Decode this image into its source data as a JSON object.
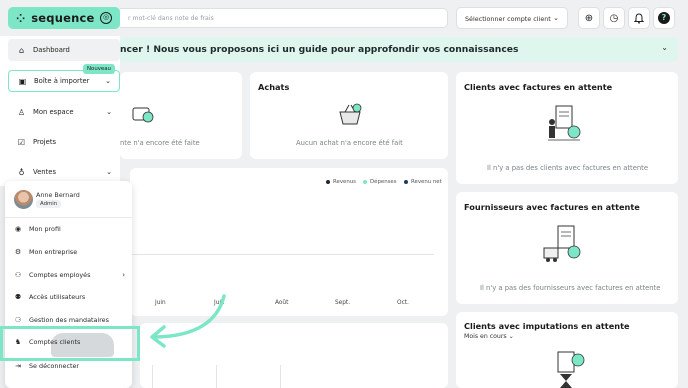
{
  "brand": {
    "name": "sequence",
    "mark": "⁘",
    "accent": "#7de6c6"
  },
  "search": {
    "placeholder": "r mot-clé dans note de frais"
  },
  "client_select": {
    "label": "Sélectionner compte client",
    "chevron": "chevron-down-icon"
  },
  "toolbar_icons": [
    "add-circle-icon",
    "clock-icon",
    "bell-icon",
    "help-icon"
  ],
  "banner": {
    "text": "ncer ! Nous vous proposons ici un guide pour approfondir vos connaissances"
  },
  "sidebar": {
    "items": [
      {
        "label": "Dashboard",
        "icon": "home-icon"
      },
      {
        "label": "Boîte à importer",
        "icon": "inbox-icon",
        "badge": "Nouveau"
      },
      {
        "label": "Mon espace",
        "icon": "user-icon"
      },
      {
        "label": "Projets",
        "icon": "check-square-icon"
      },
      {
        "label": "Ventes",
        "icon": "money-bag-icon"
      }
    ]
  },
  "cards": {
    "sales_partial": {
      "empty": "nte n'a encore été faite"
    },
    "purchases": {
      "title": "Achats",
      "empty": "Aucun achat n'a encore été fait"
    },
    "clients_pending": {
      "title": "Clients avec factures en attente",
      "empty": "Il n'y a pas des clients avec factures en attente"
    },
    "suppliers_pending": {
      "title": "Fournisseurs avec factures en attente",
      "empty": "Il n'y a pas des fournisseurs avec factures en attente"
    },
    "clients_imputations": {
      "title": "Clients avec imputations en attente",
      "period": "Mois en cours"
    }
  },
  "chart": {
    "legend": [
      {
        "label": "Revenus",
        "color": "#1f2b33"
      },
      {
        "label": "Dépenses",
        "color": "#7de6c6"
      },
      {
        "label": "Revenu net",
        "color": "#1e3a5f"
      }
    ],
    "months": [
      "Juin",
      "Juil.",
      "Août",
      "Sept.",
      "Oct."
    ]
  },
  "profile_menu": {
    "user": {
      "name": "Anne Bernard",
      "role": "Admin"
    },
    "items": [
      {
        "label": "Mon profil",
        "icon": "user-circle-icon"
      },
      {
        "label": "Mon entreprise",
        "icon": "gear-icon"
      },
      {
        "label": "Comptes employés",
        "icon": "users-icon",
        "submenu": true
      },
      {
        "label": "Accès utilisateurs",
        "icon": "user-access-icon"
      },
      {
        "label": "Gestion des mandataires",
        "icon": "delegates-icon"
      },
      {
        "label": "Comptes clients",
        "icon": "client-accounts-icon"
      },
      {
        "label": "Se déconnecter",
        "icon": "logout-icon"
      }
    ]
  }
}
